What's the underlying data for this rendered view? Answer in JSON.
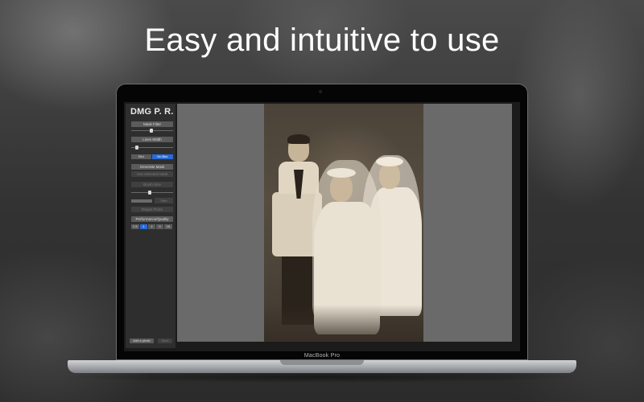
{
  "headline": "Easy and intuitive to use",
  "device_label": "MacBook Pro",
  "app": {
    "title": "DMG P. R.",
    "sidebar": {
      "mask_filter_label": "Mask Filter",
      "lines_width_label": "Lines Width",
      "blur_options": [
        "Blur",
        "No Blur"
      ],
      "blur_selected": "No Blur",
      "generate_mask_label": "Generate Mask",
      "dim_button_1_label": "Use selected mask",
      "brush_size_label": "Brush Size",
      "progress_label": "Start",
      "dim_button_2_label": "Repair Photo",
      "performance_quality_label": "Performance/Quality",
      "quality_options": [
        "0.5",
        "1",
        "4",
        "9",
        "16"
      ],
      "quality_selected": "1",
      "add_photo_label": "Add a photo",
      "save_label": "Save"
    }
  },
  "colors": {
    "accent": "#2a6bd6",
    "sidebar_bg": "#2e2e2e",
    "canvas_bg": "#6a6a6a"
  }
}
